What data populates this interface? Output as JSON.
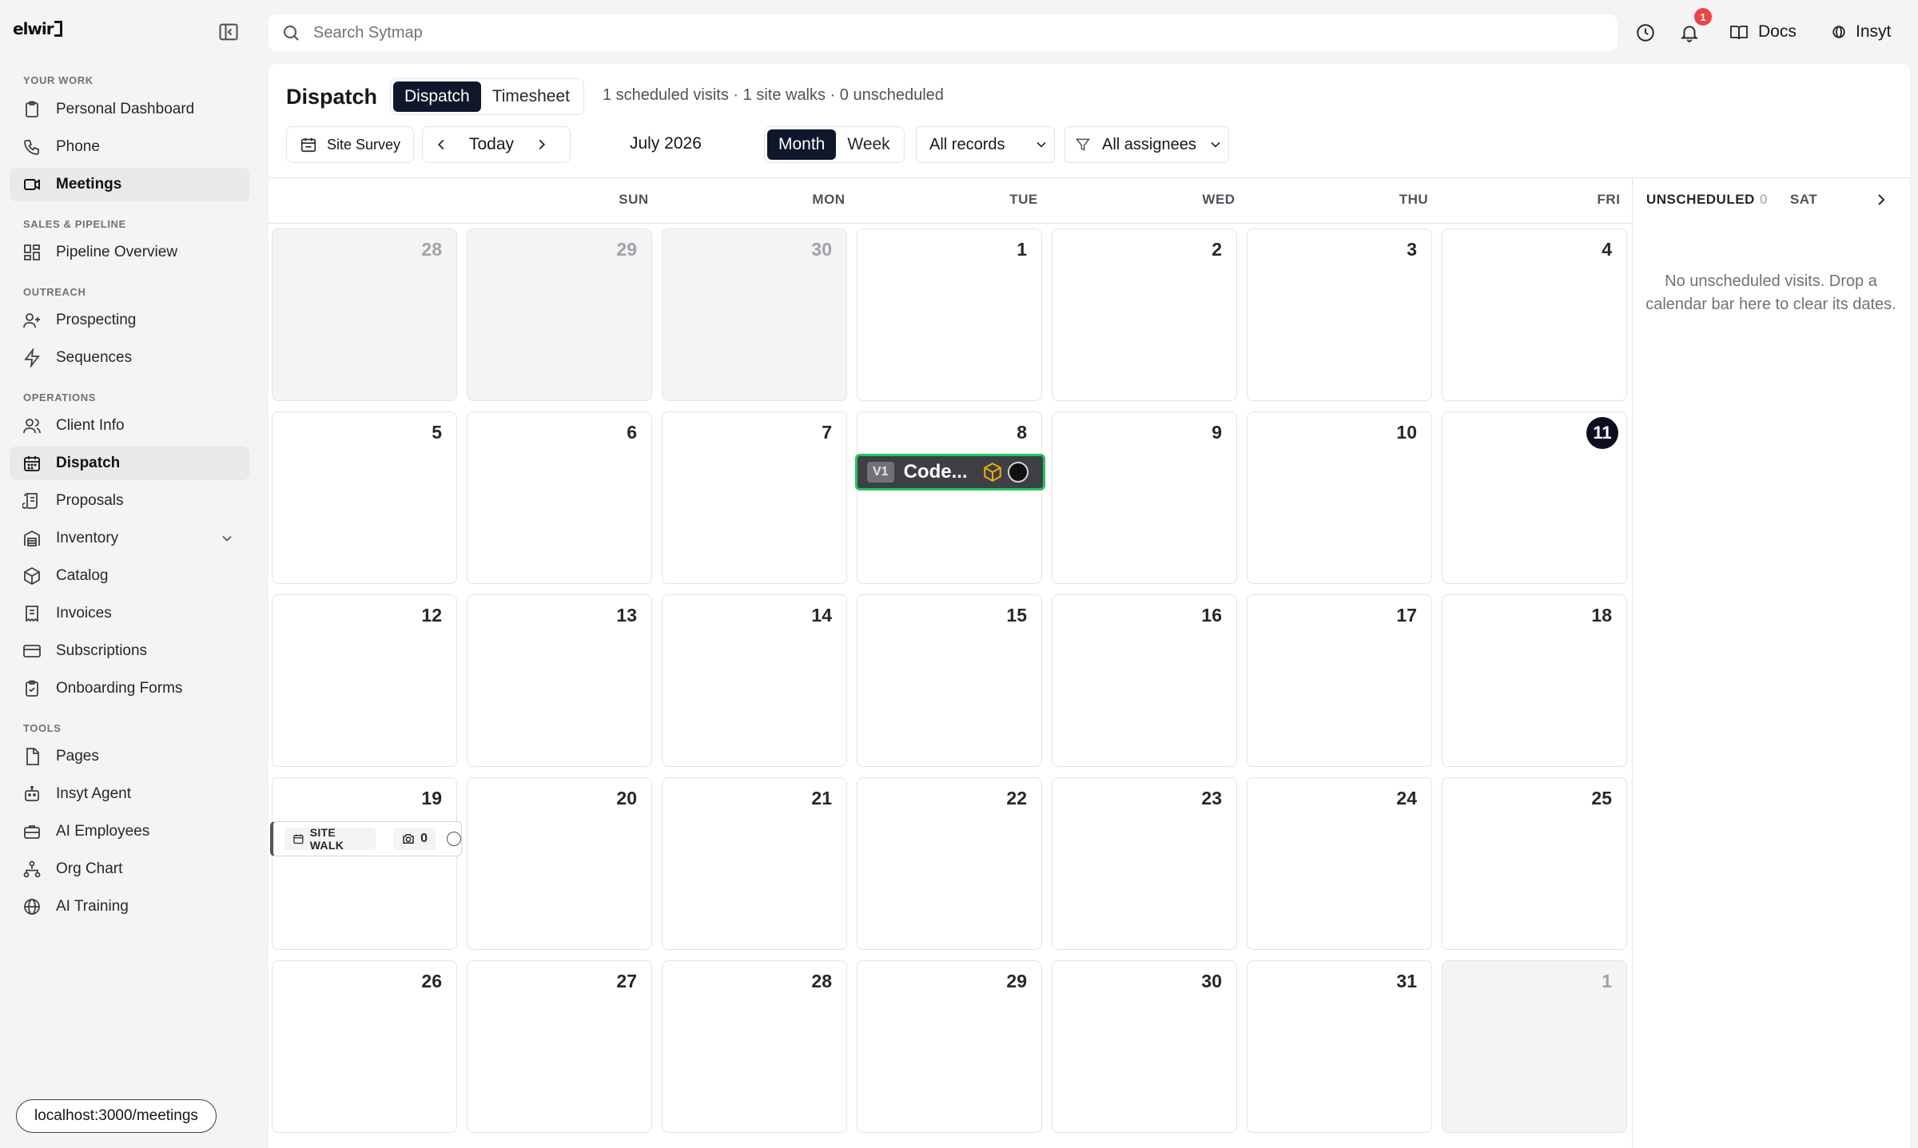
{
  "app": {
    "logo_text": "elwir"
  },
  "sidebar": {
    "sections": [
      {
        "label": "YOUR WORK"
      },
      {
        "label": "SALES & PIPELINE"
      },
      {
        "label": "OUTREACH"
      },
      {
        "label": "OPERATIONS"
      },
      {
        "label": "TOOLS"
      }
    ],
    "items": [
      {
        "label": "Personal Dashboard",
        "icon": "clipboard-icon"
      },
      {
        "label": "Phone",
        "icon": "phone-icon"
      },
      {
        "label": "Meetings",
        "icon": "video-icon"
      },
      {
        "label": "Pipeline Overview",
        "icon": "layout-grid-icon"
      },
      {
        "label": "Prospecting",
        "icon": "user-plus-icon"
      },
      {
        "label": "Sequences",
        "icon": "zap-icon"
      },
      {
        "label": "Client Info",
        "icon": "users-icon"
      },
      {
        "label": "Dispatch",
        "icon": "calendar-icon"
      },
      {
        "label": "Proposals",
        "icon": "scroll-icon"
      },
      {
        "label": "Inventory",
        "icon": "warehouse-icon"
      },
      {
        "label": "Catalog",
        "icon": "package-icon"
      },
      {
        "label": "Invoices",
        "icon": "receipt-icon"
      },
      {
        "label": "Subscriptions",
        "icon": "credit-card-icon"
      },
      {
        "label": "Onboarding Forms",
        "icon": "clipboard-check-icon"
      },
      {
        "label": "Pages",
        "icon": "file-icon"
      },
      {
        "label": "Insyt Agent",
        "icon": "bot-icon"
      },
      {
        "label": "AI Employees",
        "icon": "briefcase-icon"
      },
      {
        "label": "Org Chart",
        "icon": "network-icon"
      },
      {
        "label": "AI Training",
        "icon": "globe-icon"
      }
    ]
  },
  "status_url": "localhost:3000/meetings",
  "topbar": {
    "search_placeholder": "Search Sytmap",
    "notification_count": "1",
    "docs_label": "Docs",
    "insyt_label": "Insyt"
  },
  "page": {
    "title": "Dispatch",
    "tabs": [
      "Dispatch",
      "Timesheet"
    ],
    "summary": "1 scheduled visits · 1 site walks · 0 unscheduled"
  },
  "toolbar": {
    "template_label": "Site Survey",
    "today_label": "Today",
    "month_label": "July 2026",
    "views": [
      "Month",
      "Week"
    ],
    "records_filter": "All records",
    "assignee_filter": "All assignees"
  },
  "calendar": {
    "weekdays": [
      "SUN",
      "MON",
      "TUE",
      "WED",
      "THU",
      "FRI",
      "SAT"
    ],
    "weeks": [
      [
        "28",
        "29",
        "30",
        "1",
        "2",
        "3",
        "4"
      ],
      [
        "5",
        "6",
        "7",
        "8",
        "9",
        "10",
        "11"
      ],
      [
        "12",
        "13",
        "14",
        "15",
        "16",
        "17",
        "18"
      ],
      [
        "19",
        "20",
        "21",
        "22",
        "23",
        "24",
        "25"
      ],
      [
        "26",
        "27",
        "28",
        "29",
        "30",
        "31",
        "1"
      ]
    ],
    "today": "11"
  },
  "events": {
    "visit": {
      "tag": "V1",
      "title": "Code..."
    },
    "site_walk": {
      "tag": "SITE WALK",
      "photo_count": "0"
    }
  },
  "unscheduled": {
    "title": "UNSCHEDULED",
    "count": "0",
    "empty_message": "No unscheduled visits. Drop a calendar bar here to clear its dates."
  }
}
